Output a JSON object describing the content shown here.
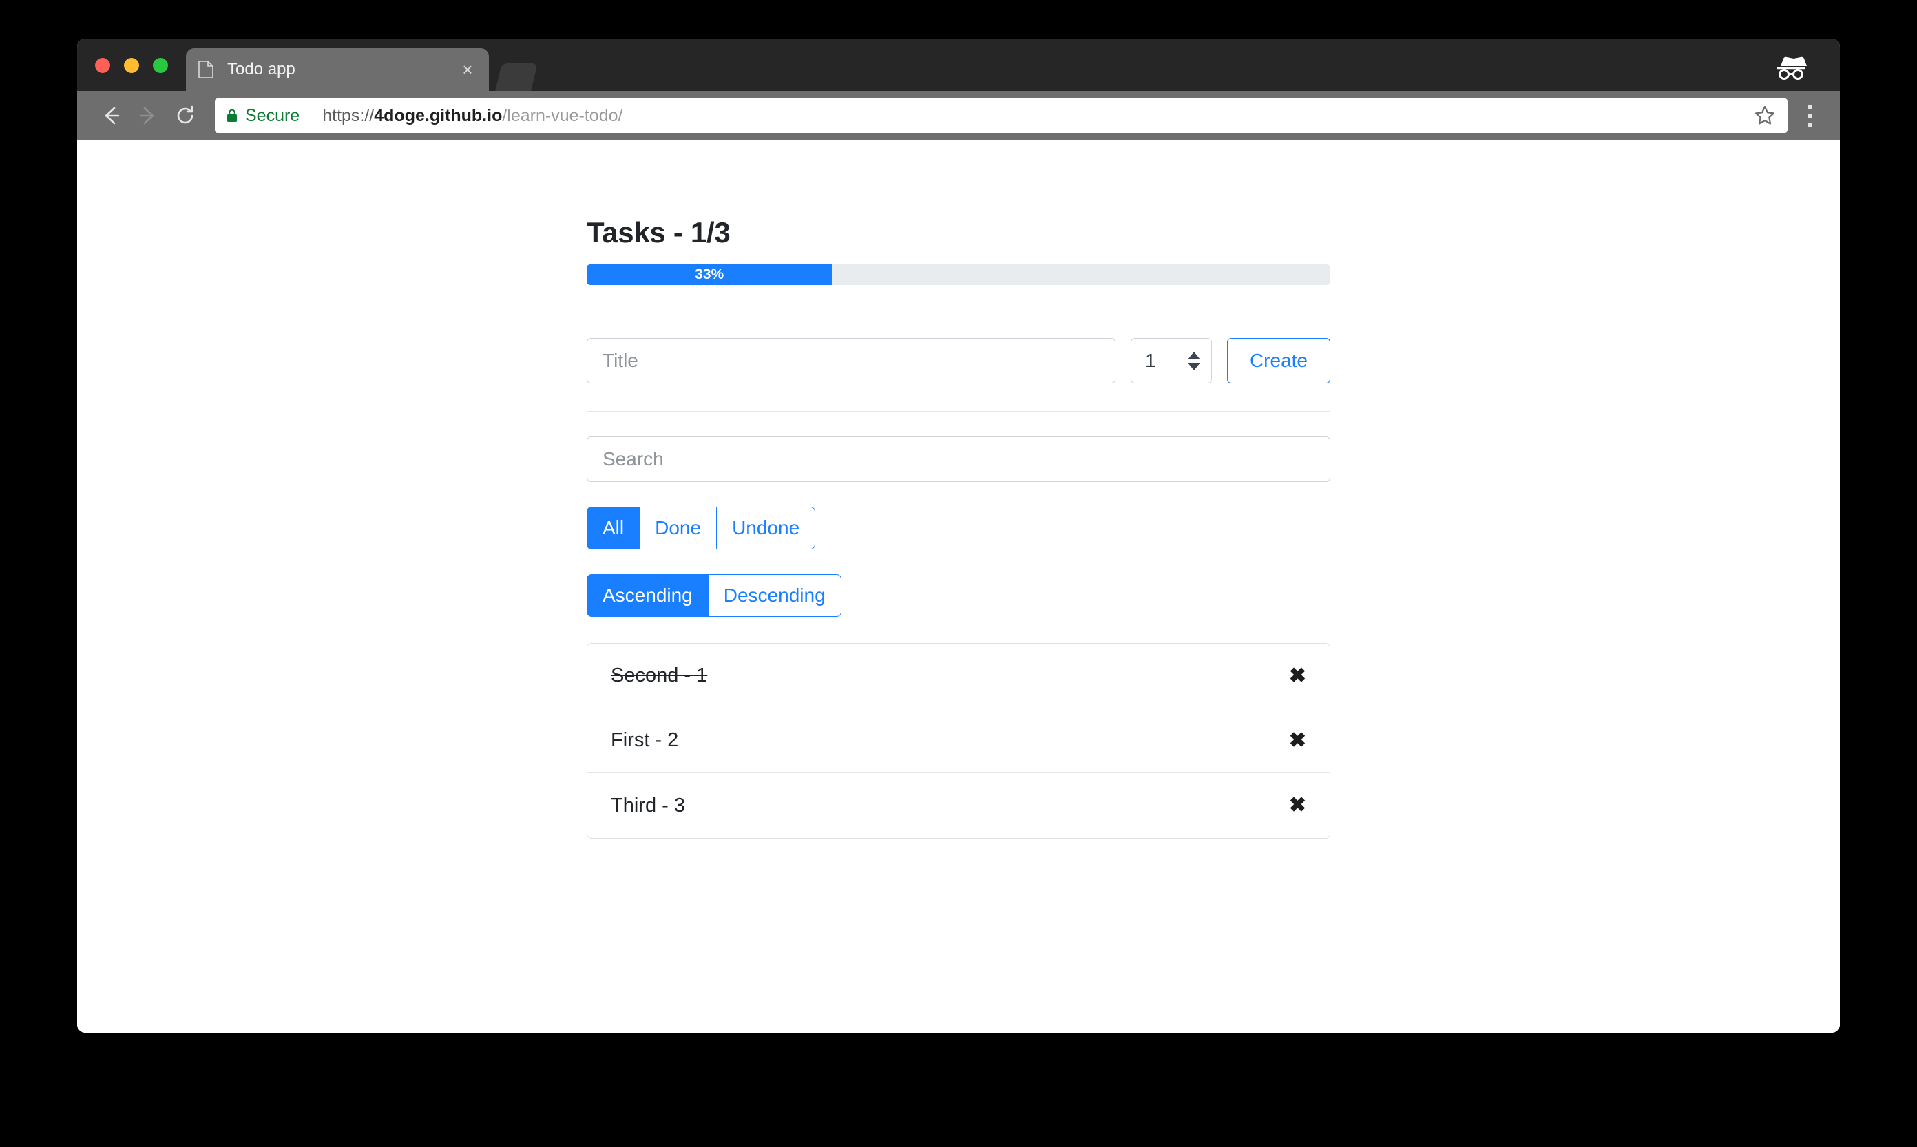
{
  "browser": {
    "window_controls": [
      {
        "name": "close",
        "color": "#ff5f57"
      },
      {
        "name": "minimize",
        "color": "#febc2e"
      },
      {
        "name": "maximize",
        "color": "#28c840"
      }
    ],
    "tab": {
      "title": "Todo app",
      "favicon": "page-icon",
      "close_label": "×"
    },
    "incognito_icon": "incognito-icon",
    "nav": {
      "back_icon": "back-arrow-icon",
      "forward_icon": "forward-arrow-icon",
      "reload_icon": "reload-icon"
    },
    "omnibox": {
      "lock_icon": "lock-icon",
      "security_label": "Secure",
      "url_full": "https://4doge.github.io/learn-vue-todo/",
      "url_scheme": "https://",
      "url_host": "4doge.github.io",
      "url_path": "/learn-vue-todo/",
      "bookmark_icon": "star-icon"
    },
    "menu_icon": "three-dot-menu-icon"
  },
  "app": {
    "title": "Tasks - 1/3",
    "progress": {
      "label": "33%",
      "percent": 33,
      "fill_color": "#1a7fff",
      "track_color": "#e9ecef"
    },
    "create": {
      "title_placeholder": "Title",
      "title_value": "",
      "count_value": "1",
      "button_label": "Create"
    },
    "search": {
      "placeholder": "Search",
      "value": ""
    },
    "filters": {
      "active": "All",
      "options": [
        {
          "label": "All",
          "active": true
        },
        {
          "label": "Done",
          "active": false
        },
        {
          "label": "Undone",
          "active": false
        }
      ]
    },
    "sort": {
      "active": "Ascending",
      "options": [
        {
          "label": "Ascending",
          "active": true
        },
        {
          "label": "Descending",
          "active": false
        }
      ]
    },
    "tasks": [
      {
        "label": "Second - 1",
        "done": true,
        "delete_label": "✖"
      },
      {
        "label": "First - 2",
        "done": false,
        "delete_label": "✖"
      },
      {
        "label": "Third - 3",
        "done": false,
        "delete_label": "✖"
      }
    ]
  }
}
